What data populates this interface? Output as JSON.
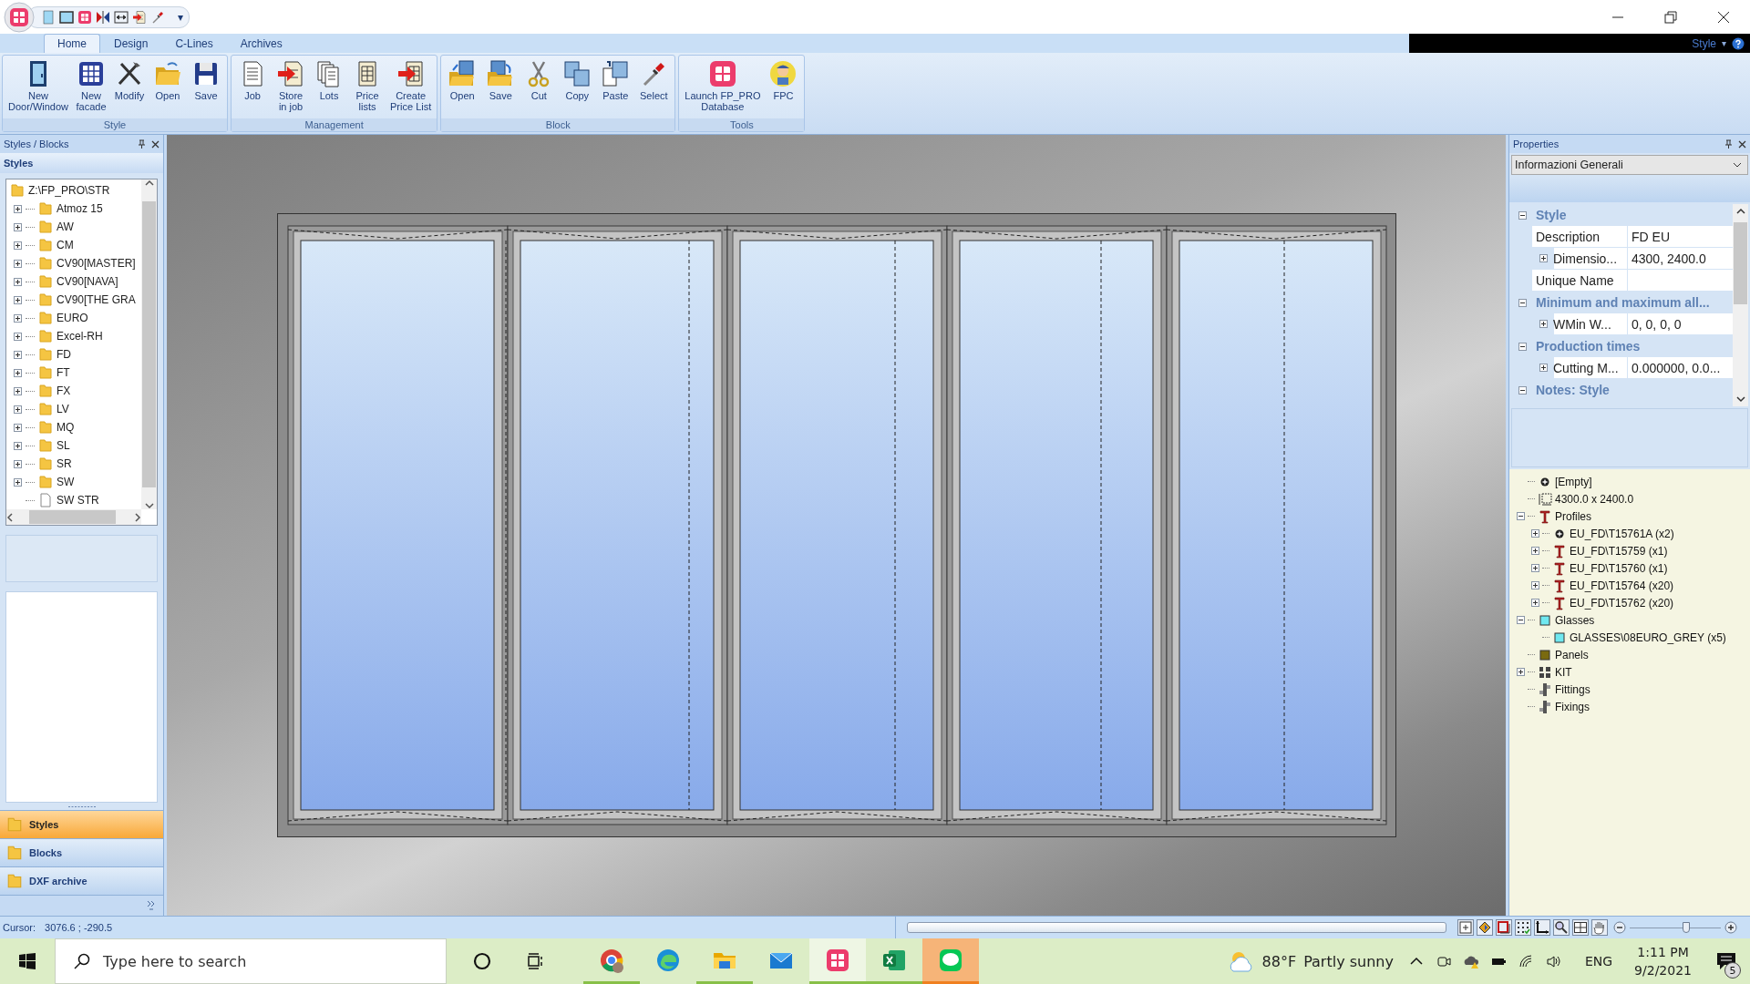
{
  "quick_access": {
    "menu_glyph": "▾"
  },
  "ribbon": {
    "tabs": [
      {
        "label": "Home",
        "selected": true
      },
      {
        "label": "Design",
        "selected": false
      },
      {
        "label": "C-Lines",
        "selected": false
      },
      {
        "label": "Archives",
        "selected": false
      }
    ],
    "style_menu": {
      "label": "Style",
      "glyph": "▾"
    },
    "groups": [
      {
        "label": "Style",
        "buttons": [
          {
            "label": "New\nDoor/Window"
          },
          {
            "label": "New\nfacade"
          },
          {
            "label": "Modify"
          },
          {
            "label": "Open"
          },
          {
            "label": "Save"
          }
        ]
      },
      {
        "label": "Management",
        "buttons": [
          {
            "label": "Job"
          },
          {
            "label": "Store\nin job"
          },
          {
            "label": "Lots"
          },
          {
            "label": "Price\nlists"
          },
          {
            "label": "Create\nPrice List"
          }
        ]
      },
      {
        "label": "Block",
        "buttons": [
          {
            "label": "Open"
          },
          {
            "label": "Save"
          },
          {
            "label": "Cut"
          },
          {
            "label": "Copy"
          },
          {
            "label": "Paste"
          },
          {
            "label": "Select"
          }
        ]
      },
      {
        "label": "Tools",
        "buttons": [
          {
            "label": "Launch FP_PRO\nDatabase"
          },
          {
            "label": "FPC"
          }
        ]
      }
    ]
  },
  "styles_panel": {
    "title": "Styles / Blocks",
    "section": "Styles",
    "tree": {
      "label": "Z:\\FP_PRO\\STR",
      "children": [
        {
          "label": "Atmoz 15",
          "kind": "folder",
          "expanded": false
        },
        {
          "label": "AW",
          "kind": "folder",
          "expanded": false
        },
        {
          "label": "CM",
          "kind": "folder",
          "expanded": false
        },
        {
          "label": "CV90[MASTER]",
          "kind": "folder",
          "expanded": false
        },
        {
          "label": "CV90[NAVA]",
          "kind": "folder",
          "expanded": false
        },
        {
          "label": "CV90[THE GRA",
          "kind": "folder",
          "expanded": false
        },
        {
          "label": "EURO",
          "kind": "folder",
          "expanded": false
        },
        {
          "label": "Excel-RH",
          "kind": "folder",
          "expanded": false
        },
        {
          "label": "FD",
          "kind": "folder",
          "expanded": false
        },
        {
          "label": "FT",
          "kind": "folder",
          "expanded": false
        },
        {
          "label": "FX",
          "kind": "folder",
          "expanded": false
        },
        {
          "label": "LV",
          "kind": "folder",
          "expanded": false
        },
        {
          "label": "MQ",
          "kind": "folder",
          "expanded": false
        },
        {
          "label": "SL",
          "kind": "folder",
          "expanded": false
        },
        {
          "label": "SR",
          "kind": "folder",
          "expanded": false
        },
        {
          "label": "SW",
          "kind": "folder",
          "expanded": false
        },
        {
          "label": "SW STR",
          "kind": "file"
        }
      ]
    },
    "nav": [
      {
        "label": "Styles",
        "selected": true
      },
      {
        "label": "Blocks",
        "selected": false
      },
      {
        "label": "DXF archive",
        "selected": false
      }
    ]
  },
  "properties": {
    "title": "Properties",
    "dropdown": {
      "value": "Informazioni Generali"
    },
    "categories": [
      {
        "label": "Style",
        "expanded": true,
        "rows": [
          {
            "name": "Description",
            "value": "FD EU",
            "kind": "plain"
          },
          {
            "name": "Dimensio...",
            "value": "4300, 2400.0",
            "kind": "group"
          },
          {
            "name": "Unique Name",
            "kind": "plain"
          }
        ]
      },
      {
        "label": "Minimum and maximum all...",
        "expanded": true,
        "rows": [
          {
            "name": "WMin W...",
            "value": "0, 0, 0, 0",
            "kind": "group"
          }
        ]
      },
      {
        "label": "Production times",
        "expanded": true,
        "rows": [
          {
            "name": "Cutting M...",
            "value": "0.000000, 0.0...",
            "kind": "group"
          }
        ]
      },
      {
        "label": "Notes: Style",
        "expanded": true
      }
    ],
    "tree": [
      {
        "label": "[Empty]",
        "kind": "empty"
      },
      {
        "label": "4300.0 x 2400.0",
        "kind": "dimension"
      },
      {
        "label": "Profiles",
        "kind": "profile",
        "expanded": true,
        "children": [
          {
            "label": "EU_FD\\T15761A (x2)",
            "kind": "empty",
            "expanded": false
          },
          {
            "label": "EU_FD\\T15759 (x1)",
            "kind": "profile",
            "expanded": false
          },
          {
            "label": "EU_FD\\T15760 (x1)",
            "kind": "profile",
            "expanded": false
          },
          {
            "label": "EU_FD\\T15764 (x20)",
            "kind": "profile",
            "expanded": false
          },
          {
            "label": "EU_FD\\T15762 (x20)",
            "kind": "profile",
            "expanded": false
          }
        ]
      },
      {
        "label": "Glasses",
        "kind": "glass",
        "expanded": true,
        "children": [
          {
            "label": "GLASSES\\08EURO_GREY (x5)",
            "kind": "glass"
          }
        ]
      },
      {
        "label": "Panels",
        "kind": "panel"
      },
      {
        "label": "KIT",
        "kind": "kit",
        "expanded": false
      },
      {
        "label": "Fittings",
        "kind": "fitting"
      },
      {
        "label": "Fixings",
        "kind": "fitting"
      }
    ]
  },
  "status_bar": {
    "cursor_label": "Cursor:",
    "cursor_value": "3076.6 ; -290.5",
    "zoom_slider": {
      "level": 0.62
    }
  },
  "taskbar": {
    "search": {
      "placeholder": "Type here to search"
    },
    "apps": [
      {
        "kind": "chrome",
        "running": true,
        "active": false,
        "attention": false
      },
      {
        "kind": "edge",
        "running": false,
        "active": false,
        "attention": false
      },
      {
        "kind": "explorer",
        "running": true,
        "active": false,
        "attention": false
      },
      {
        "kind": "mail",
        "running": false,
        "active": false,
        "attention": false
      },
      {
        "kind": "fp_pro",
        "running": true,
        "active": true,
        "attention": false
      },
      {
        "kind": "excel",
        "running": true,
        "active": false,
        "attention": false
      },
      {
        "kind": "line",
        "running": true,
        "active": false,
        "attention": true
      }
    ],
    "weather": {
      "temperature": "88°F",
      "condition": "Partly sunny"
    },
    "language": "ENG",
    "time": "1:11 PM",
    "date": "9/2/2021",
    "notifications": "5"
  }
}
